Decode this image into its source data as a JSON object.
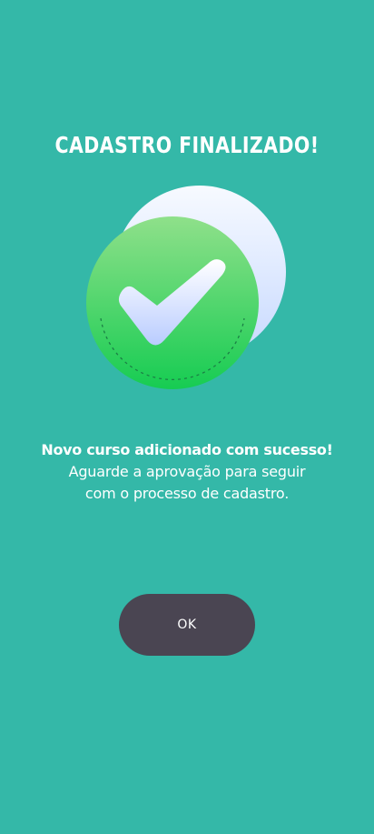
{
  "screen": {
    "title": "CADASTRO FINALIZADO!",
    "illustration": {
      "icon": "checkmark-success",
      "colors": {
        "background": "#34b8a8",
        "circle_back": "#dbe6ff",
        "circle_front": "#3fd26a",
        "check": "#eef4ff"
      }
    },
    "message": {
      "headline": "Novo curso adicionado com sucesso!",
      "line1": "Aguarde a aprovação para seguir",
      "line2": "com o processo de cadastro."
    },
    "button": {
      "label": "OK",
      "color": "#4a4552"
    }
  }
}
